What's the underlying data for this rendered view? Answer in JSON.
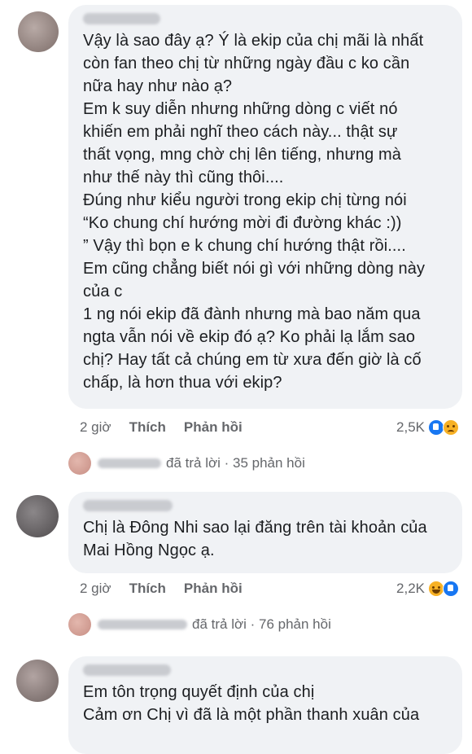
{
  "comments": [
    {
      "text": "Vậy là sao đây ạ? Ý là ekip của chị mãi là nhất\ncòn fan theo chị từ những ngày đầu c ko cần\nnữa hay như nào ạ?\nEm k suy diễn nhưng những dòng c viết nó\nkhiến em phải nghĩ theo cách này... thật sự\nthất vọng, mng chờ chị lên tiếng, nhưng mà\nnhư thế này thì cũng thôi....\nĐúng như kiểu người trong ekip chị từng nói\n“Ko chung chí hướng mời đi đường khác :))\n” Vậy thì bọn e k chung chí hướng thật rồi....\nEm cũng chẳng biết nói gì với những dòng này\ncủa c\n1 ng nói ekip đã đành nhưng mà bao năm qua\nngta vẫn nói về ekip đó ạ? Ko phải lạ lắm sao\nchị? Hay tất cả chúng em từ xưa đến giờ là cố\nchấp, là hơn thua với ekip?",
      "time": "2 giờ",
      "like": "Thích",
      "reply": "Phản hồi",
      "reaction_count": "2,5K",
      "reactions": [
        "like-icon",
        "sad-icon"
      ],
      "replies_text": "đã trả lời · 35 phản hồi"
    },
    {
      "text": "Chị là Đông Nhi sao lại đăng trên tài khoản của\nMai Hồng Ngọc ạ.",
      "time": "2 giờ",
      "like": "Thích",
      "reply": "Phản hồi",
      "reaction_count": "2,2K",
      "reactions": [
        "haha-icon",
        "like-icon"
      ],
      "replies_text": "đã trả lời · 76 phản hồi"
    },
    {
      "text": "Em tôn trọng quyết định của chị\nCảm ơn Chị vì đã là một phần thanh xuân của"
    }
  ]
}
